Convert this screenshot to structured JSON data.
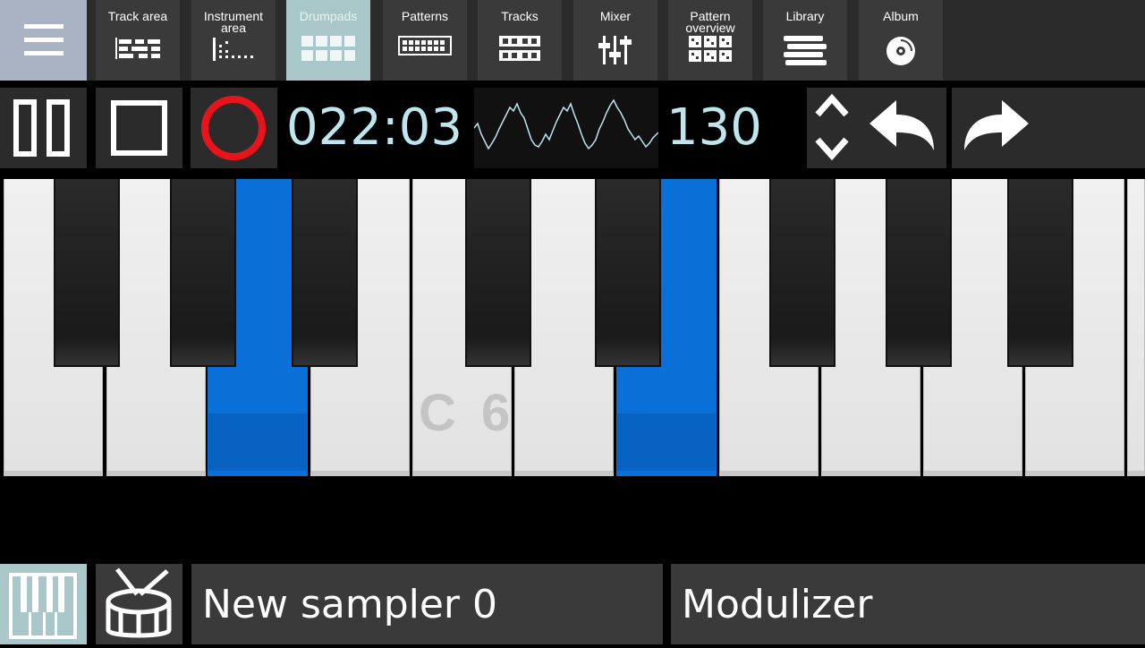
{
  "nav": {
    "menu_icon": "hamburger-menu-icon",
    "tabs": [
      {
        "label": "Track area",
        "icon": "track-area-icon"
      },
      {
        "label": "Instrument area",
        "icon": "instrument-area-icon"
      },
      {
        "label": "Drumpads",
        "icon": "drumpads-icon",
        "active": true
      },
      {
        "label": "Patterns",
        "icon": "patterns-icon"
      },
      {
        "label": "Tracks",
        "icon": "tracks-icon"
      },
      {
        "label": "Mixer",
        "icon": "mixer-icon"
      },
      {
        "label": "Pattern overview",
        "icon": "pattern-overview-icon"
      },
      {
        "label": "Library",
        "icon": "library-icon"
      },
      {
        "label": "Album",
        "icon": "album-icon"
      }
    ]
  },
  "transport": {
    "time": "022:03",
    "bpm": "130",
    "record_color": "#e8141c",
    "display_color": "#bfe6ee"
  },
  "keyboard": {
    "octave_label": "C 6",
    "white_keys": [
      "F",
      "G",
      "A",
      "B",
      "C",
      "D",
      "E",
      "F",
      "G",
      "A",
      "B",
      "C"
    ],
    "active_color": "#0a6fd6"
  },
  "bottom": {
    "instrument_name": "New sampler 0",
    "effect_name": "Modulizer"
  }
}
